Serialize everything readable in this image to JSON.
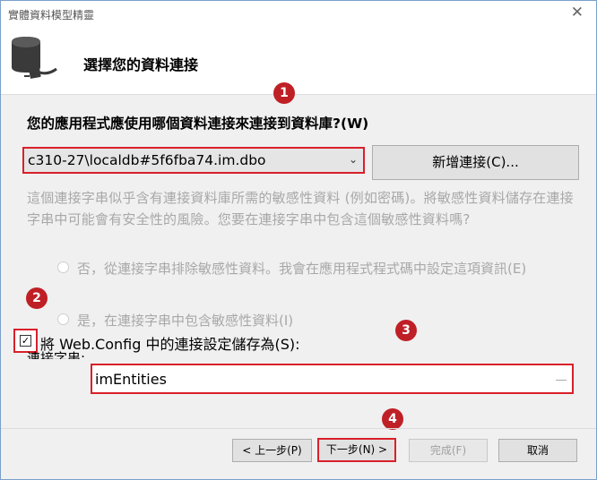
{
  "window": {
    "title": "實體資料模型精靈",
    "close_glyph": "✕"
  },
  "header": {
    "title": "選擇您的資料連接",
    "icon": "database-connection-icon"
  },
  "question": "您的應用程式應使用哪個資料連接來連接到資料庫?(W)",
  "connection": {
    "selected": "c310-27\\localdb#5f6fba74.im.dbo",
    "new_button": "新增連接(C)..."
  },
  "sensitive": {
    "description": "這個連接字串似乎含有連接資料庫所需的敏感性資料 (例如密碼)。將敏感性資料儲存在連接字串中可能會有安全性的風險。您要在連接字串中包含這個敏感性資料嗎?",
    "option_exclude": "否，從連接字串排除敏感性資料。我會在應用程式程式碼中設定這項資訊(E)",
    "option_include": "是，在連接字串中包含敏感性資料(I)"
  },
  "save": {
    "checkbox_label": "將 Web.Config 中的連接設定儲存為(S):",
    "checked_glyph": "✓",
    "connection_string_label": "連接字串:",
    "entity_name": "imEntities"
  },
  "badges": [
    "1",
    "2",
    "3",
    "4"
  ],
  "footer": {
    "prev": "< 上一步(P)",
    "next": "下一步(N) >",
    "finish": "完成(F)",
    "cancel": "取消"
  },
  "colors": {
    "highlight": "#d9202a",
    "badge": "#bf2026"
  }
}
